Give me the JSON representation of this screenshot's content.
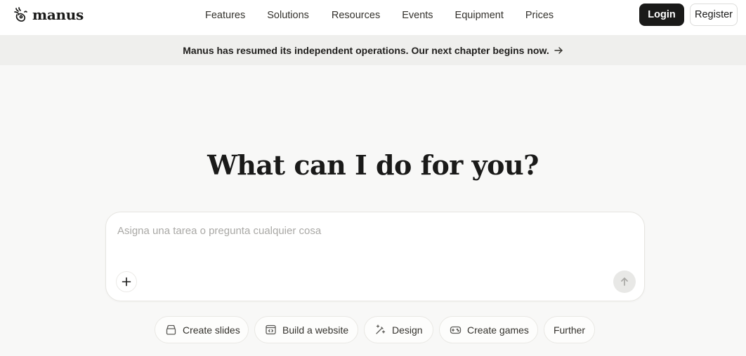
{
  "header": {
    "logo_text": "manus",
    "nav": [
      "Features",
      "Solutions",
      "Resources",
      "Events",
      "Equipment",
      "Prices"
    ],
    "login_label": "Login",
    "register_label": "Register"
  },
  "banner": {
    "text": "Manus has resumed its independent operations. Our next chapter begins now."
  },
  "hero": {
    "title": "What can I do for you?"
  },
  "task_input": {
    "placeholder": "Asigna una tarea o pregunta cualquier cosa",
    "value": ""
  },
  "chips": [
    {
      "label": "Create slides",
      "icon": "slides-icon"
    },
    {
      "label": "Build a website",
      "icon": "code-window-icon"
    },
    {
      "label": "Design",
      "icon": "magic-wand-icon"
    },
    {
      "label": "Create games",
      "icon": "gamepad-icon"
    },
    {
      "label": "Further",
      "icon": ""
    }
  ],
  "colors": {
    "background": "#f8f8f7",
    "header": "#ffffff",
    "banner": "#efefed",
    "primary_button": "#1a1a19",
    "text": "#34322d"
  }
}
